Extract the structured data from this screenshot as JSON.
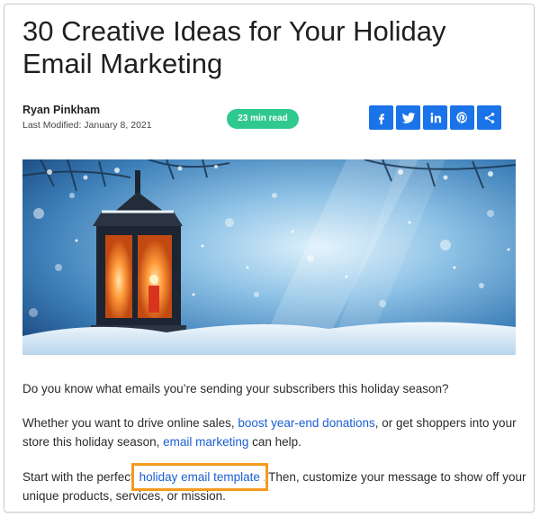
{
  "article": {
    "title": "30 Creative Ideas for Your Holiday Email Marketing",
    "author": "Ryan Pinkham",
    "modified": "Last Modified: January 8, 2021",
    "read_time": "23 min read"
  },
  "share": {
    "icons": [
      "facebook-icon",
      "twitter-icon",
      "linkedin-icon",
      "pinterest-icon",
      "share-icon"
    ],
    "color": "#1a73e8"
  },
  "badge_color": "#2fc98f",
  "highlight_color": "#f59a1c",
  "paragraphs": {
    "p1": "Do you know what emails you’re sending your subscribers this holiday season?",
    "p2_a": "Whether you want to drive online sales, ",
    "p2_link1": "boost year-end donations",
    "p2_b": ", or get shoppers into your store this holiday season, ",
    "p2_link2": "email marketing",
    "p2_c": " can help.",
    "p3_a": "Start with the perfect ",
    "p3_link": "holiday email template",
    "p3_b": ". Then, customize your message to show off your unique products, services, or mission."
  }
}
